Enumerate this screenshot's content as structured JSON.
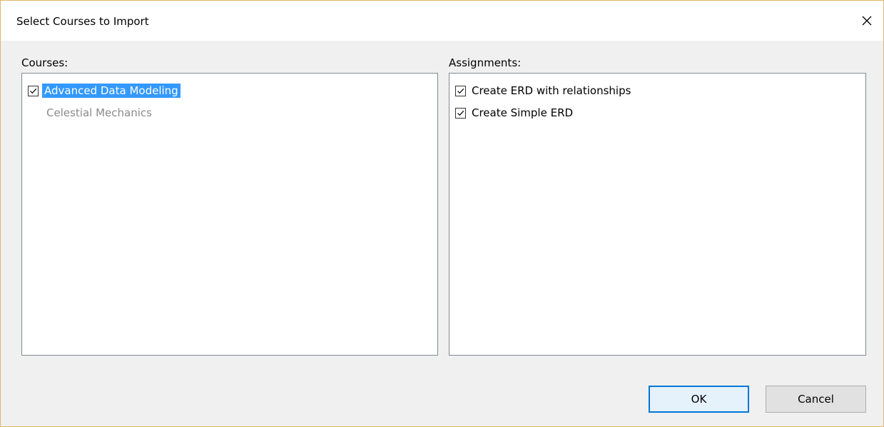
{
  "dialog": {
    "title": "Select Courses to Import"
  },
  "courses": {
    "label": "Courses:",
    "items": [
      {
        "label": "Advanced Data Modeling",
        "checked": true,
        "selected": true,
        "enabled": true
      },
      {
        "label": "Celestial Mechanics",
        "checked": false,
        "selected": false,
        "enabled": false
      }
    ]
  },
  "assignments": {
    "label": "Assignments:",
    "items": [
      {
        "label": "Create ERD with relationships",
        "checked": true
      },
      {
        "label": "Create Simple ERD",
        "checked": true
      }
    ]
  },
  "buttons": {
    "ok": "OK",
    "cancel": "Cancel"
  },
  "colors": {
    "selection": "#3399ff",
    "default_button_border": "#0078d7",
    "window_border": "#e3b66a",
    "disabled_text": "#8a8a8a"
  }
}
